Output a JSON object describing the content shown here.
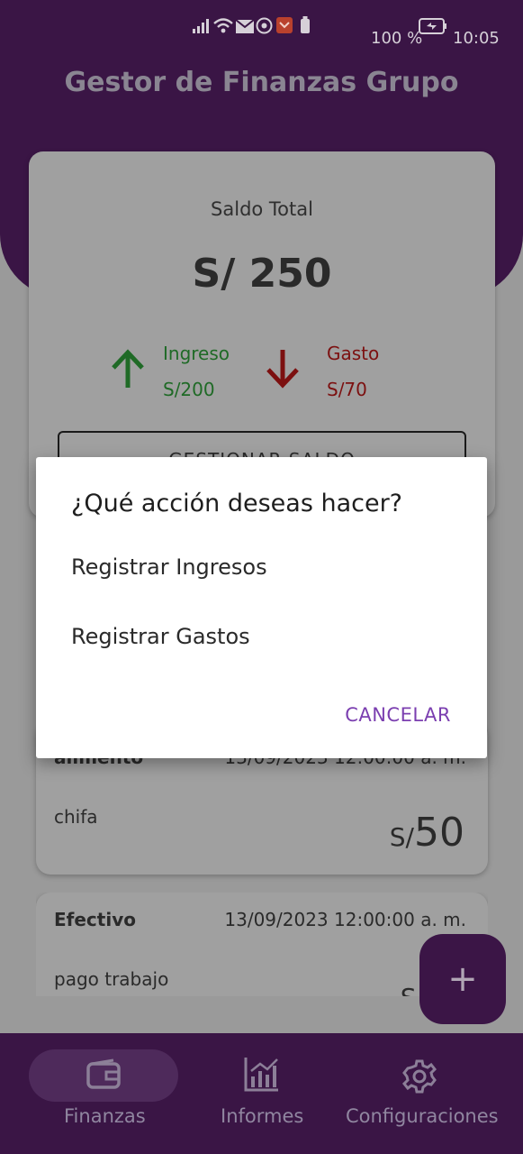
{
  "status_bar": {
    "battery_percent": "100 %",
    "time": "10:05"
  },
  "app_title": "Gestor de Finanzas Grupo",
  "balance_card": {
    "label": "Saldo Total",
    "amount": "S/ 250",
    "income": {
      "label": "Ingreso",
      "value": "S/200",
      "color": "#1f7a2a"
    },
    "expense": {
      "label": "Gasto",
      "value": "S/70",
      "color": "#8a1010"
    },
    "manage_button": "GESTIONAR SALDO"
  },
  "transactions": [
    {
      "category": "alimento",
      "date": "13/09/2023 12:00:00 a. m.",
      "description": "chifa",
      "currency": "S/",
      "amount": "50"
    },
    {
      "category": "Efectivo",
      "date": "13/09/2023 12:00:00 a. m.",
      "description": "pago trabajo",
      "currency": "S/",
      "amount": ""
    }
  ],
  "fab": {
    "label": "+"
  },
  "bottom_nav": [
    {
      "label": "Finanzas",
      "icon": "wallet-icon",
      "active": true
    },
    {
      "label": "Informes",
      "icon": "chart-icon",
      "active": false
    },
    {
      "label": "Configuraciones",
      "icon": "gear-icon",
      "active": false
    }
  ],
  "dialog": {
    "title": "¿Qué acción deseas hacer?",
    "options": [
      "Registrar Ingresos",
      "Registrar Gastos"
    ],
    "cancel": "CANCELAR"
  }
}
